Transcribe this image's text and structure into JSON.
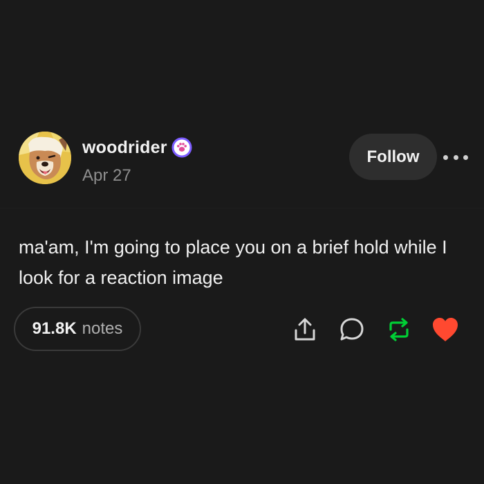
{
  "post": {
    "username": "woodrider",
    "date": "Apr 27",
    "follow_label": "Follow",
    "text": "ma'am, I'm going to place you on a brief hold while I look for a reaction image",
    "notes_count": "91.8K",
    "notes_label": "notes"
  },
  "icons": {
    "badge": "paw-badge-icon",
    "more": "more-dots-icon",
    "share": "share-icon",
    "reply": "reply-bubble-icon",
    "reblog": "reblog-icon",
    "like": "heart-icon"
  },
  "colors": {
    "background": "#1a1a1a",
    "reblog": "#00cf35",
    "like": "#ff4930",
    "badge": "#7c5cff"
  }
}
